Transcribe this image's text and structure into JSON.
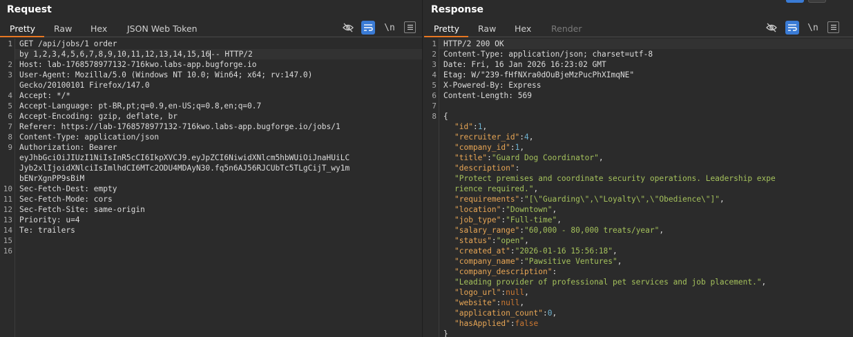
{
  "request": {
    "title": "Request",
    "tabs": [
      "Pretty",
      "Raw",
      "Hex",
      "JSON Web Token"
    ],
    "active_tab": "Pretty",
    "lines": [
      {
        "n": "1",
        "text": "GET /api/jobs/1 order"
      },
      {
        "n": "",
        "text": "by 1,2,3,4,5,6,7,8,9,10,11,12,13,14,15,16-- HTTP/2"
      },
      {
        "n": "2",
        "text": "Host: lab-1768578977132-716kwo.labs-app.bugforge.io"
      },
      {
        "n": "3",
        "text": "User-Agent: Mozilla/5.0 (Windows NT 10.0; Win64; x64; rv:147.0)"
      },
      {
        "n": "",
        "text": "Gecko/20100101 Firefox/147.0"
      },
      {
        "n": "4",
        "text": "Accept: */*"
      },
      {
        "n": "5",
        "text": "Accept-Language: pt-BR,pt;q=0.9,en-US;q=0.8,en;q=0.7"
      },
      {
        "n": "6",
        "text": "Accept-Encoding: gzip, deflate, br"
      },
      {
        "n": "7",
        "text": "Referer: https://lab-1768578977132-716kwo.labs-app.bugforge.io/jobs/1"
      },
      {
        "n": "8",
        "text": "Content-Type: application/json"
      },
      {
        "n": "9",
        "text": "Authorization: Bearer"
      },
      {
        "n": "",
        "text": "eyJhbGciOiJIUzI1NiIsInR5cCI6IkpXVCJ9.eyJpZCI6NiwidXNlcm5hbWUiOiJnaHUiLC"
      },
      {
        "n": "",
        "text": "Jyb2xlIjoidXNlciIsImlhdCI6MTc2ODU4MDAyN30.fq5n6AJ56RJCUbTc5TLgCijT_wy1m"
      },
      {
        "n": "",
        "text": "bENrXgnPP9sBiM"
      },
      {
        "n": "10",
        "text": "Sec-Fetch-Dest: empty"
      },
      {
        "n": "11",
        "text": "Sec-Fetch-Mode: cors"
      },
      {
        "n": "12",
        "text": "Sec-Fetch-Site: same-origin"
      },
      {
        "n": "13",
        "text": "Priority: u=4"
      },
      {
        "n": "14",
        "text": "Te: trailers"
      },
      {
        "n": "15",
        "text": ""
      },
      {
        "n": "16",
        "text": ""
      }
    ]
  },
  "response": {
    "title": "Response",
    "tabs": [
      "Pretty",
      "Raw",
      "Hex",
      "Render"
    ],
    "active_tab": "Pretty",
    "headers": [
      {
        "n": "1",
        "text": "HTTP/2 200 OK"
      },
      {
        "n": "2",
        "text": "Content-Type: application/json; charset=utf-8"
      },
      {
        "n": "3",
        "text": "Date: Fri, 16 Jan 2026 16:23:02 GMT"
      },
      {
        "n": "4",
        "text": "Etag: W/\"239-fHfNXra0dOuBjeMzPucPhXImqNE\""
      },
      {
        "n": "5",
        "text": "X-Powered-By: Express"
      },
      {
        "n": "6",
        "text": "Content-Length: 569"
      },
      {
        "n": "7",
        "text": ""
      },
      {
        "n": "8",
        "text": "{"
      }
    ],
    "json": [
      {
        "key": "\"id\"",
        "val": "1",
        "type": "num",
        "comma": ","
      },
      {
        "key": "\"recruiter_id\"",
        "val": "4",
        "type": "num",
        "comma": ","
      },
      {
        "key": "\"company_id\"",
        "val": "1",
        "type": "num",
        "comma": ","
      },
      {
        "key": "\"title\"",
        "val": "\"Guard Dog Coordinator\"",
        "type": "str",
        "comma": ","
      },
      {
        "key": "\"description\"",
        "val": "",
        "type": "str",
        "comma": ""
      },
      {
        "key": "",
        "val": "\"Protect premises and coordinate security operations. Leadership expe",
        "type": "str",
        "comma": ""
      },
      {
        "key": "",
        "val": "rience required.\"",
        "type": "str",
        "comma": ","
      },
      {
        "key": "\"requirements\"",
        "val": "\"[\\\"Guarding\\\",\\\"Loyalty\\\",\\\"Obedience\\\"]\"",
        "type": "str",
        "comma": ","
      },
      {
        "key": "\"location\"",
        "val": "\"Downtown\"",
        "type": "str",
        "comma": ","
      },
      {
        "key": "\"job_type\"",
        "val": "\"Full-time\"",
        "type": "str",
        "comma": ","
      },
      {
        "key": "\"salary_range\"",
        "val": "\"60,000 - 80,000 treats/year\"",
        "type": "str",
        "comma": ","
      },
      {
        "key": "\"status\"",
        "val": "\"open\"",
        "type": "str",
        "comma": ","
      },
      {
        "key": "\"created_at\"",
        "val": "\"2026-01-16 15:56:18\"",
        "type": "str",
        "comma": ","
      },
      {
        "key": "\"company_name\"",
        "val": "\"Pawsitive Ventures\"",
        "type": "str",
        "comma": ","
      },
      {
        "key": "\"company_description\"",
        "val": "",
        "type": "str",
        "comma": ""
      },
      {
        "key": "",
        "val": "\"Leading provider of professional pet services and job placement.\"",
        "type": "str",
        "comma": ","
      },
      {
        "key": "\"logo_url\"",
        "val": "null",
        "type": "lit",
        "comma": ","
      },
      {
        "key": "\"website\"",
        "val": "null",
        "type": "lit",
        "comma": ","
      },
      {
        "key": "\"application_count\"",
        "val": "0",
        "type": "num",
        "comma": ","
      },
      {
        "key": "\"hasApplied\"",
        "val": "false",
        "type": "lit",
        "comma": ""
      }
    ],
    "closing": "}"
  },
  "icons": {
    "hide": "eye-slash-icon",
    "wrap": "word-wrap-icon",
    "newline": "\\n",
    "menu": "menu-icon"
  },
  "colors": {
    "accent": "#e87722",
    "active_button": "#3a7bd5",
    "background": "#2b2b2b"
  }
}
